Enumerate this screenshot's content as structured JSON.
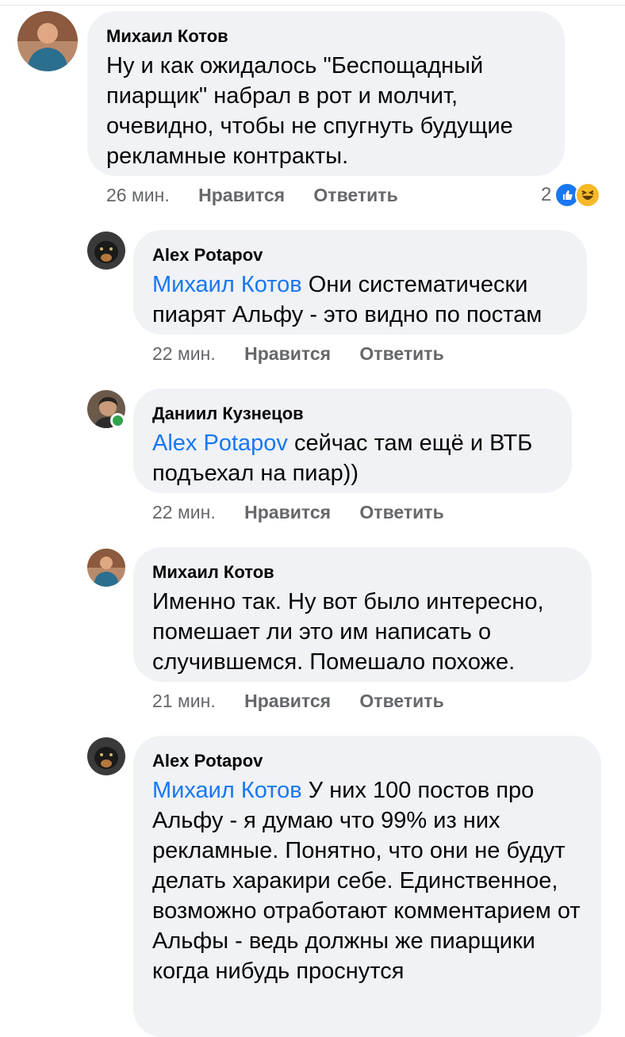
{
  "comments": [
    {
      "author": "Михаил Котов",
      "mention": "",
      "text": "Ну и как ожидалось \"Беспощадный пиарщик\" набрал в рот и молчит, очевидно, чтобы не спугнуть будущие рекламные контракты.",
      "time": "26 мин.",
      "like_label": "Нравится",
      "reply_label": "Ответить",
      "reaction_count": "2",
      "reactions": [
        "like-icon",
        "haha-icon"
      ]
    },
    {
      "author": "Alex Potapov",
      "mention": "Михаил Котов",
      "text": "Они систематически пиарят Альфу - это видно по постам",
      "time": "22 мин.",
      "like_label": "Нравится",
      "reply_label": "Ответить"
    },
    {
      "author": "Даниил Кузнецов",
      "mention": "Alex Potapov",
      "text": "сейчас там ещё и ВТБ подъехал на пиар))",
      "time": "22 мин.",
      "like_label": "Нравится",
      "reply_label": "Ответить",
      "online": true
    },
    {
      "author": "Михаил Котов",
      "mention": "",
      "text": "Именно так. Ну вот было интересно, помешает ли это им написать о случившемся. Помешало похоже.",
      "time": "21 мин.",
      "like_label": "Нравится",
      "reply_label": "Ответить"
    },
    {
      "author": "Alex Potapov",
      "mention": "Михаил Котов",
      "text": "У них 100 постов про Альфу - я думаю что 99% из них рекламные. Понятно, что они не будут делать харакири себе. Единственное, возможно отработают комментарием от Альфы - ведь должны же пиарщики когда нибудь проснутся"
    }
  ],
  "colors": {
    "bubble": "#f0f2f5",
    "mention": "#1877f2",
    "meta": "#65676b",
    "online": "#31a24c"
  }
}
